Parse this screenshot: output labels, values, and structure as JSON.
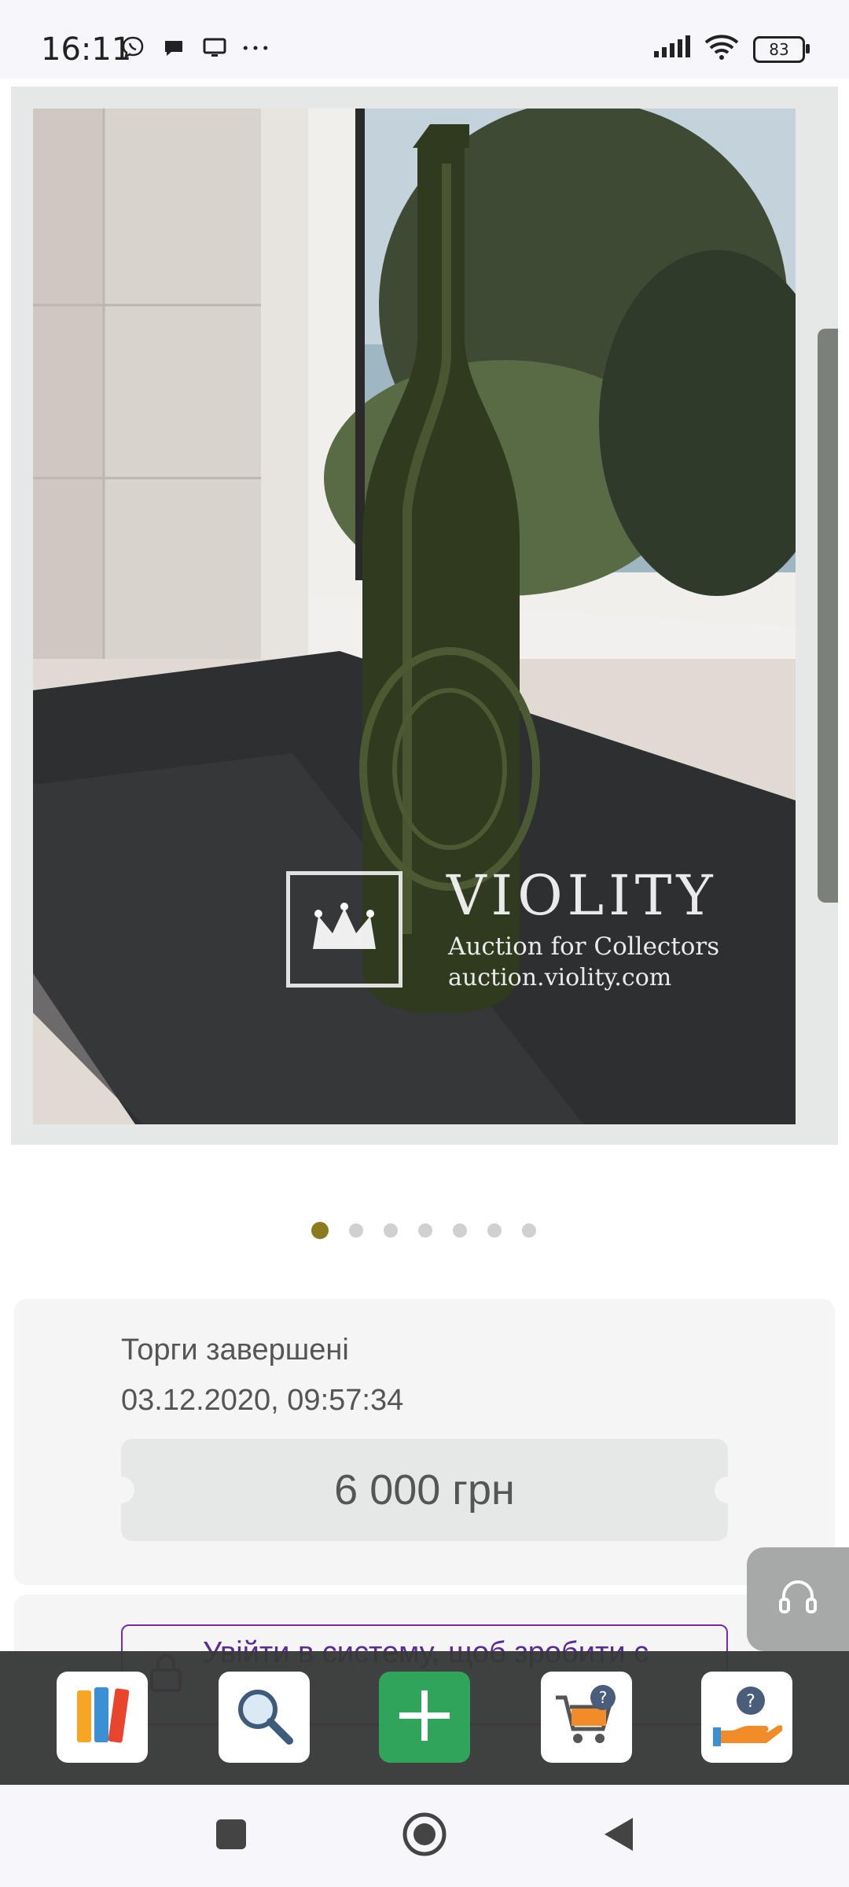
{
  "status_bar": {
    "time": "16:11",
    "battery_level": "83",
    "icons_left": [
      "viber-icon",
      "chat-icon",
      "monitor-icon",
      "more-icon"
    ],
    "icons_right": [
      "signal-icon",
      "wifi-icon",
      "battery-icon"
    ]
  },
  "gallery": {
    "image_count": 7,
    "active_index": 0,
    "watermark": {
      "brand": "VIOLITY",
      "tagline": "Auction for Collectors",
      "url": "auction.violity.com"
    }
  },
  "auction": {
    "status": "Торги завершені",
    "end_datetime": "03.12.2020, 09:57:34",
    "price": "6 000 грн"
  },
  "login_prompt": {
    "label": "Увійти в систему, щоб зробити с"
  },
  "bottom_nav": {
    "items": [
      "catalog-icon",
      "search-icon",
      "add-icon",
      "cart-help-icon",
      "help-hand-icon"
    ]
  },
  "colors": {
    "accent_purple": "#7a2aa8",
    "active_dot": "#8c7b1e",
    "add_green": "#2fa45a"
  }
}
